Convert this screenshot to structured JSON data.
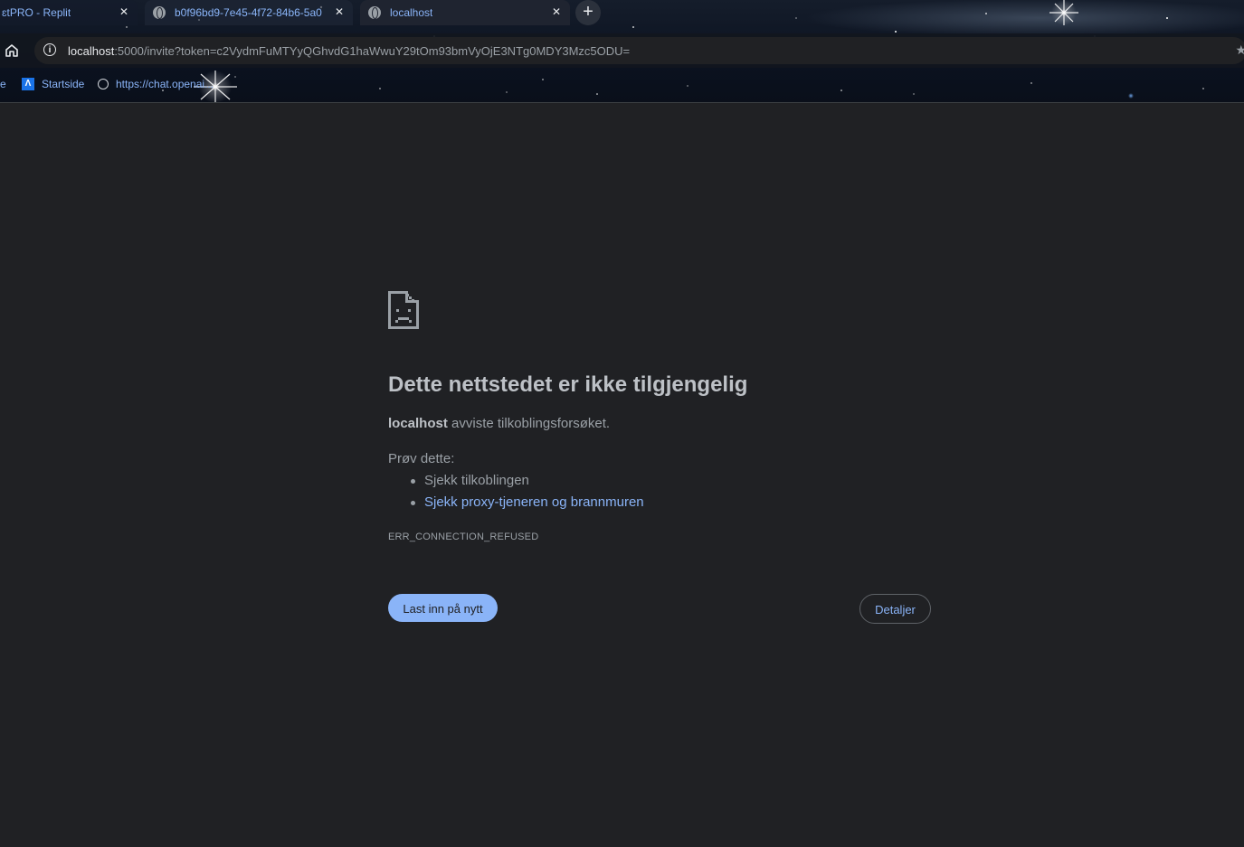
{
  "tabs": [
    {
      "title": "ɛtPRO - Replit"
    },
    {
      "title": "b0f96bd9-7e45-4f72-84b6-5a0"
    },
    {
      "title": "localhost",
      "active": true
    }
  ],
  "new_tab_label": "+",
  "close_glyph": "✕",
  "address_bar": {
    "host": "localhost",
    "rest": ":5000/invite?token=c2VydmFuMTYyQGhvdG1haWwuY29tOm93bmVyOjE3NTg0MDY3Mzc5ODU="
  },
  "bookmarks": [
    {
      "label": "e"
    },
    {
      "label": "Startside",
      "icon": "a-logo-icon"
    },
    {
      "label": "https://chat.openai..."
    }
  ],
  "error": {
    "title": "Dette nettstedet er ikke tilgjengelig",
    "host": "localhost",
    "message": " avviste tilkoblingsforsøket.",
    "try_label": "Prøv dette:",
    "suggestions": [
      "Sjekk tilkoblingen",
      "Sjekk proxy-tjeneren og brannmuren"
    ],
    "code": "ERR_CONNECTION_REFUSED",
    "reload_label": "Last inn på nytt",
    "details_label": "Detaljer"
  },
  "colors": {
    "page_bg": "#202124",
    "link": "#8ab4f8",
    "text": "#9aa0a6"
  }
}
